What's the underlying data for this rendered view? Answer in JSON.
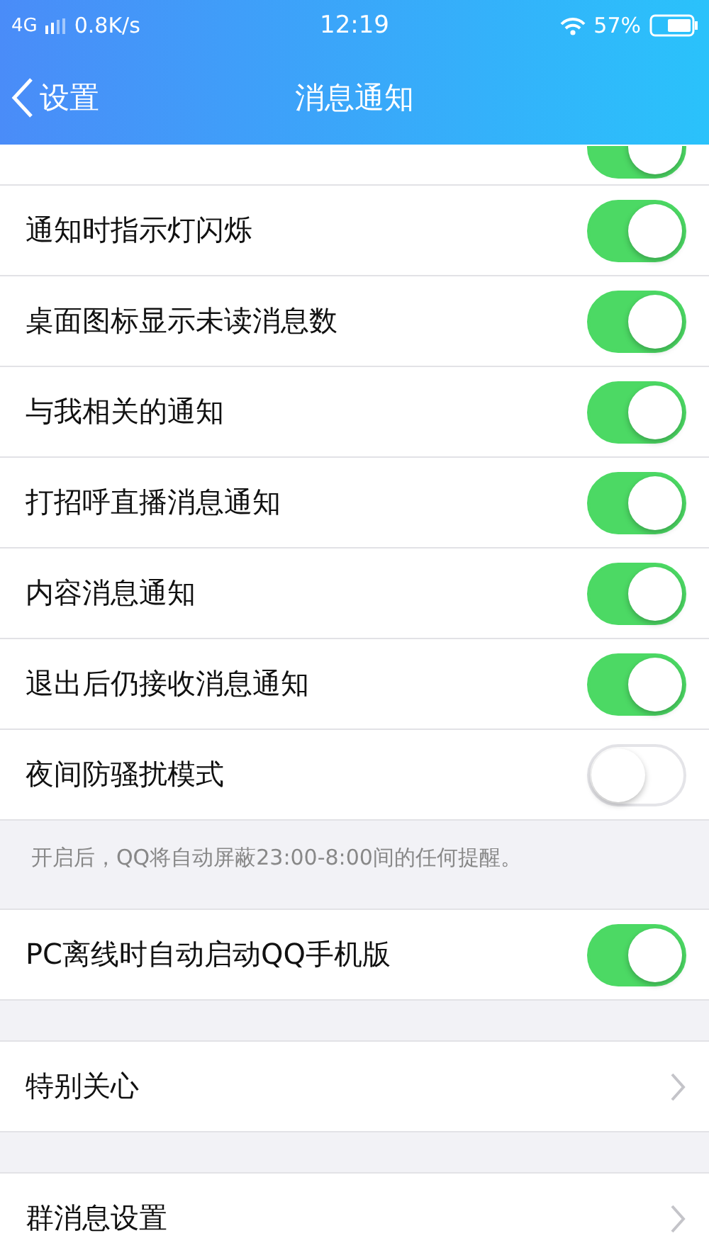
{
  "status_bar": {
    "network": "4G",
    "speed": "0.8K/s",
    "time": "12:19",
    "battery": "57%"
  },
  "nav": {
    "back": "设置",
    "title": "消息通知"
  },
  "sections": [
    {
      "rows": [
        {
          "kind": "switch",
          "on": true
        },
        {
          "kind": "switch",
          "label": "通知时指示灯闪烁",
          "on": true
        },
        {
          "kind": "switch",
          "label": "桌面图标显示未读消息数",
          "on": true
        },
        {
          "kind": "switch",
          "label": "与我相关的通知",
          "on": true
        },
        {
          "kind": "switch",
          "label": "打招呼直播消息通知",
          "on": true
        },
        {
          "kind": "switch",
          "label": "内容消息通知",
          "on": true
        },
        {
          "kind": "switch",
          "label": "退出后仍接收消息通知",
          "on": true
        },
        {
          "kind": "switch",
          "label": "夜间防骚扰模式",
          "on": false
        }
      ],
      "note": "开启后，QQ将自动屏蔽23:00-8:00间的任何提醒。"
    },
    {
      "rows": [
        {
          "kind": "switch",
          "label": "PC离线时自动启动QQ手机版",
          "on": true
        }
      ]
    },
    {
      "rows": [
        {
          "kind": "link",
          "label": "特别关心"
        }
      ]
    },
    {
      "rows": [
        {
          "kind": "link",
          "label": "群消息设置"
        }
      ]
    }
  ]
}
